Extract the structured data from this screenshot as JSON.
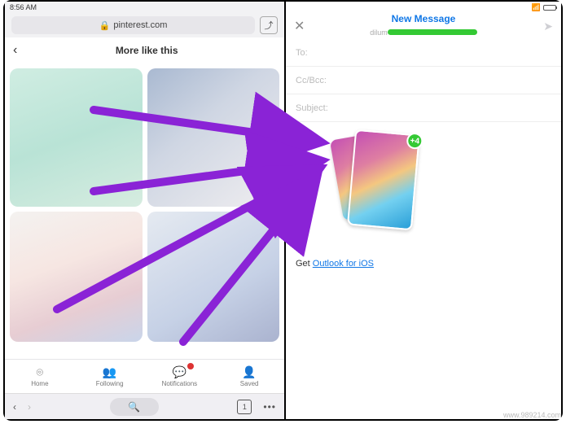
{
  "statusbar": {
    "time": "8:56 AM"
  },
  "browser": {
    "url_host": "pinterest.com",
    "lock": "🔒",
    "page_title": "More like this",
    "back": "‹",
    "actions_btn": "⤴"
  },
  "bottombar": {
    "items": [
      {
        "icon": "⌾",
        "label": "Home"
      },
      {
        "icon": "👥",
        "label": "Following"
      },
      {
        "icon": "💬",
        "label": "Notifications"
      },
      {
        "icon": "👤",
        "label": "Saved"
      }
    ]
  },
  "systoolbar": {
    "back": "‹",
    "fwd": "›",
    "search": "🔍",
    "tab_count": "1",
    "more": "•••"
  },
  "mail": {
    "close": "✕",
    "title": "New Message",
    "from_prefix": "dilum",
    "send": "➤",
    "fields": {
      "to": "To:",
      "ccbcc": "Cc/Bcc:",
      "subject": "Subject:"
    },
    "cursor": "|",
    "attach_badge": "+4",
    "signature_prefix": "Get ",
    "signature_link": "Outlook for iOS"
  },
  "watermark": "www.989214.com",
  "arrows": {
    "color": "#8a23d6"
  }
}
